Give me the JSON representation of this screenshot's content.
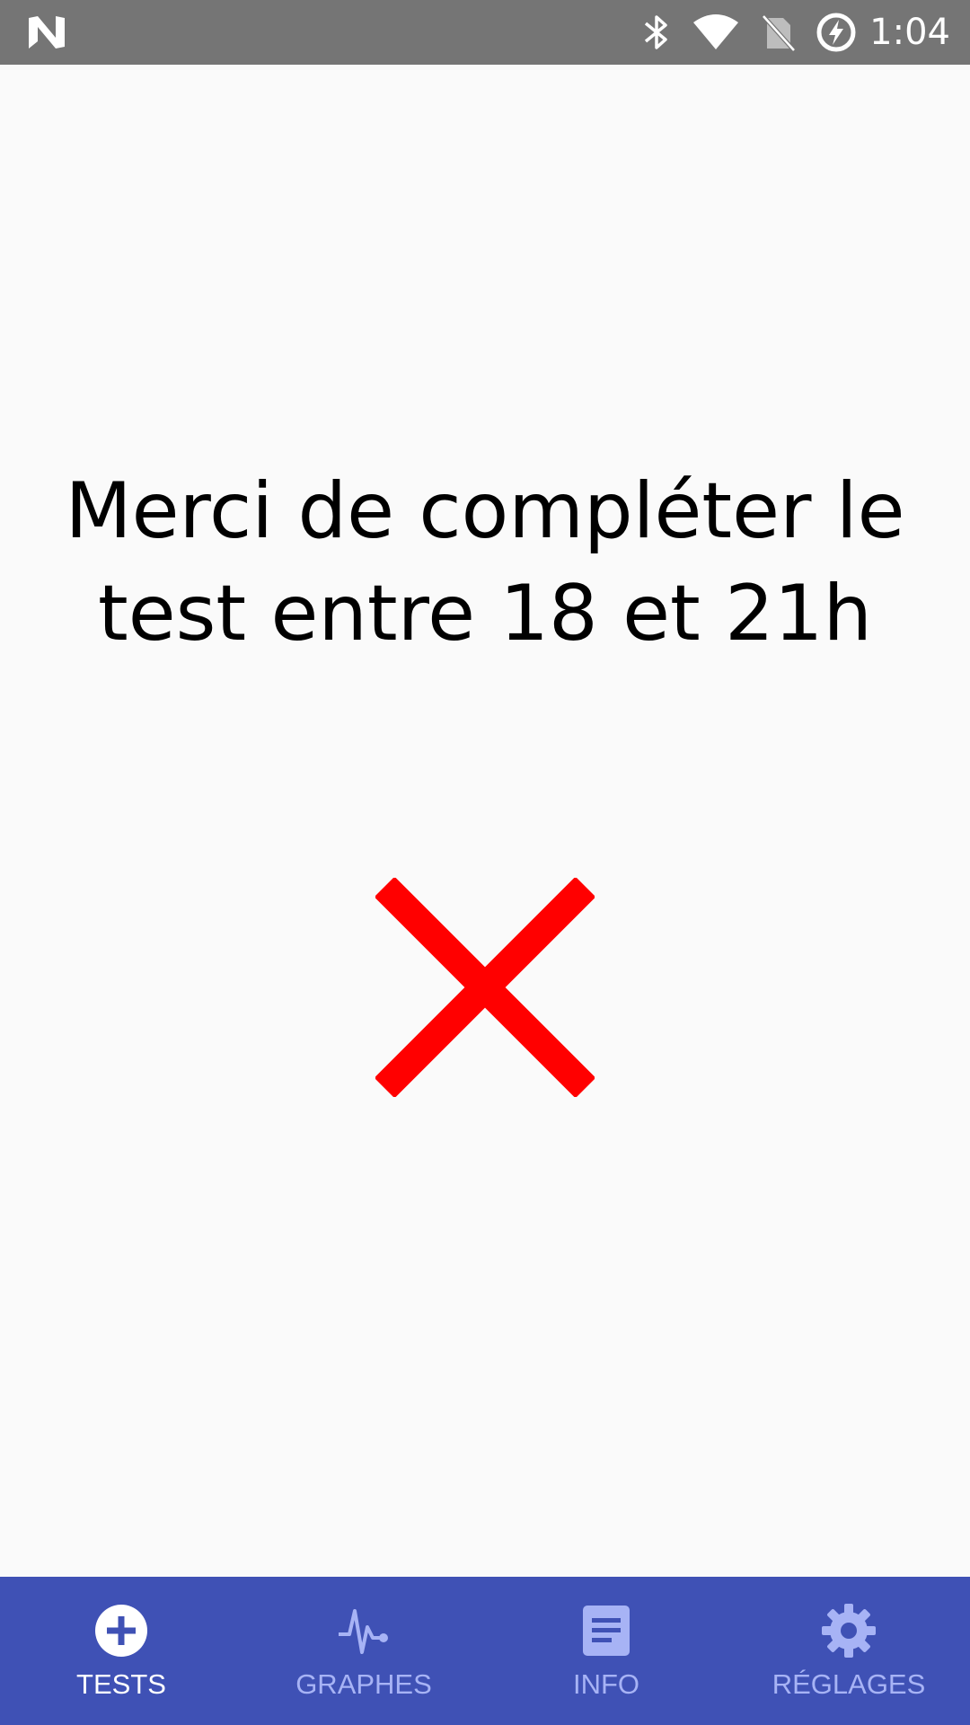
{
  "status_bar": {
    "time": "1:04",
    "icons": [
      "n-logo-icon",
      "bluetooth-icon",
      "wifi-icon",
      "no-sim-icon",
      "battery-charging-icon"
    ]
  },
  "main": {
    "message_line1": "Merci de compléter le",
    "message_line2": "test entre 18 et 21h",
    "status_icon": "cross-icon",
    "status_color": "#ff0000"
  },
  "bottom_nav": {
    "background": "#3f51b5",
    "active_color": "#ffffff",
    "inactive_color": "#a7b3f5",
    "items": [
      {
        "label": "TESTS",
        "icon": "add-circle-icon",
        "active": true
      },
      {
        "label": "GRAPHES",
        "icon": "pulse-icon",
        "active": false
      },
      {
        "label": "INFO",
        "icon": "document-icon",
        "active": false
      },
      {
        "label": "RÉGLAGES",
        "icon": "gear-icon",
        "active": false
      }
    ]
  }
}
